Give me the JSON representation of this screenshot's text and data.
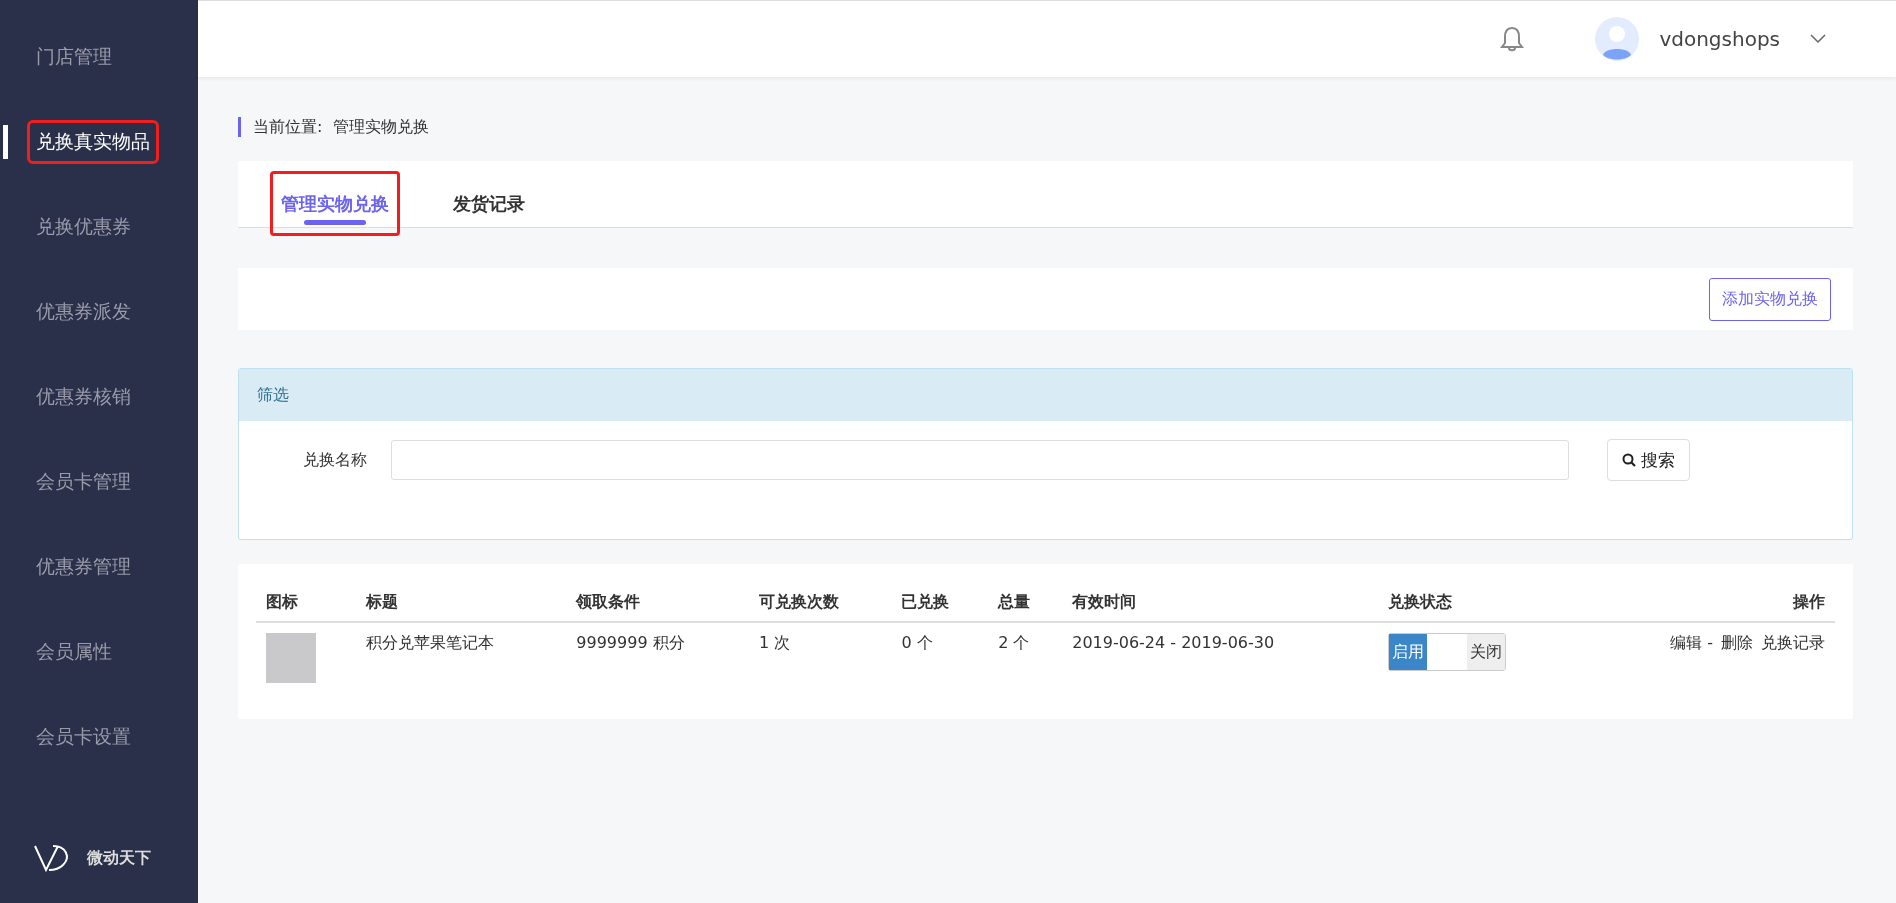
{
  "sidebar": {
    "items": [
      {
        "label": "门店管理",
        "selected": false,
        "highlighted": false
      },
      {
        "label": "兑换真实物品",
        "selected": true,
        "highlighted": true
      },
      {
        "label": "兑换优惠券",
        "selected": false,
        "highlighted": false
      },
      {
        "label": "优惠券派发",
        "selected": false,
        "highlighted": false
      },
      {
        "label": "优惠券核销",
        "selected": false,
        "highlighted": false
      },
      {
        "label": "会员卡管理",
        "selected": false,
        "highlighted": false
      },
      {
        "label": "优惠券管理",
        "selected": false,
        "highlighted": false
      },
      {
        "label": "会员属性",
        "selected": false,
        "highlighted": false
      },
      {
        "label": "会员卡设置",
        "selected": false,
        "highlighted": false
      }
    ],
    "brand": "微动天下"
  },
  "header": {
    "username": "vdongshops"
  },
  "breadcrumb": {
    "label": "当前位置:",
    "current": "管理实物兑换"
  },
  "tabs": [
    {
      "label": "管理实物兑换",
      "selected": true,
      "highlighted": true
    },
    {
      "label": "发货记录",
      "selected": false,
      "highlighted": false
    }
  ],
  "add_button": "添加实物兑换",
  "filter": {
    "title": "筛选",
    "field_label": "兑换名称",
    "search_button": "搜索"
  },
  "table": {
    "columns": [
      "图标",
      "标题",
      "领取条件",
      "可兑换次数",
      "已兑换",
      "总量",
      "有效时间",
      "兑换状态",
      "操作"
    ],
    "rows": [
      {
        "title": "积分兑苹果笔记本",
        "condition": "9999999 积分",
        "times": "1 次",
        "redeemed": "0 个",
        "total": "2 个",
        "period": "2019-06-24 - 2019-06-30",
        "status": {
          "on": true,
          "on_label": "启用",
          "off_label": "关闭"
        },
        "actions": [
          "编辑 -",
          "删除",
          "兑换记录"
        ]
      }
    ]
  }
}
